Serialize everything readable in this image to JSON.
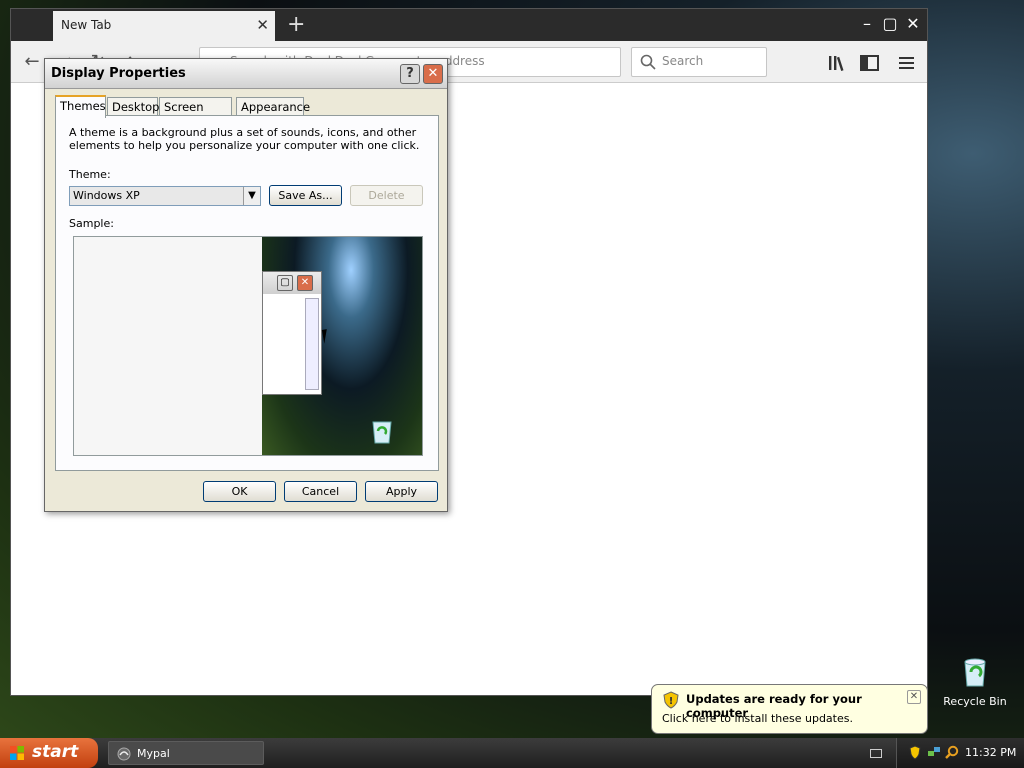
{
  "desktop": {
    "icons": [
      {
        "label": "Recycle Bin",
        "icon": "recycle-bin-icon"
      }
    ]
  },
  "browser": {
    "tab_title": "New Tab",
    "url_placeholder": "Search with DuckDuckGo or enter address",
    "search_placeholder": "Search",
    "window_controls": {
      "minimize": "minimize-icon",
      "maximize": "maximize-icon",
      "close": "close-icon"
    },
    "toolbar_icons": [
      "library-icon",
      "sidebar-icon",
      "menu-icon"
    ]
  },
  "dialog": {
    "title": "Display Properties",
    "tabs": [
      {
        "label": "Themes",
        "active": true
      },
      {
        "label": "Desktop"
      },
      {
        "label": "Screen Saver"
      },
      {
        "label": "Appearance"
      }
    ],
    "description": "A theme is a background plus a set of sounds, icons, and other elements to help you personalize your computer with one click.",
    "theme_label": "Theme:",
    "theme_value": "Windows XP",
    "save_as_label": "Save As...",
    "delete_label": "Delete",
    "sample_label": "Sample:",
    "ok_label": "OK",
    "cancel_label": "Cancel",
    "apply_label": "Apply"
  },
  "balloon": {
    "title": "Updates are ready for your computer",
    "text": "Click here to install these updates."
  },
  "taskbar": {
    "start_label": "start",
    "task_item": "Mypal",
    "clock": "11:32 PM",
    "tray_icons": [
      "security-shield-icon",
      "network-icon",
      "search-icon"
    ]
  },
  "colors": {
    "start_button": "#d9561e",
    "balloon_bg": "#ffffe1",
    "dialog_bg": "#ece9d8",
    "close_button": "#d96d4a",
    "active_tab_accent": "#e6a326"
  }
}
